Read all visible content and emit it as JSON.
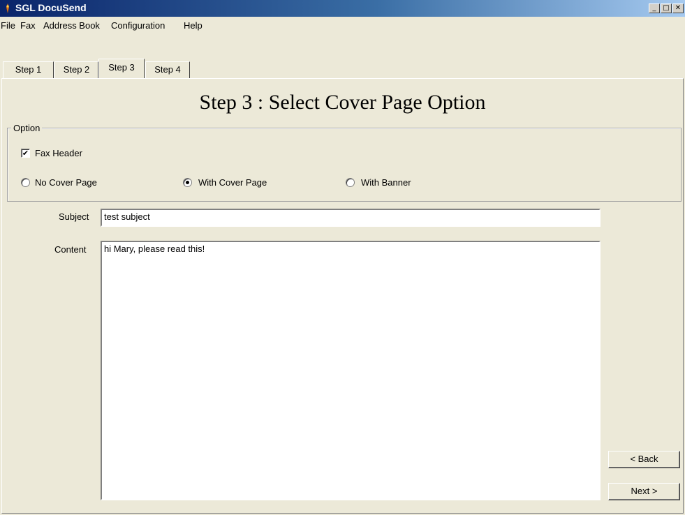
{
  "window": {
    "title": "SGL DocuSend",
    "minimize": "_",
    "maximize": "□",
    "close": "✕"
  },
  "menu": [
    "File",
    "Fax",
    "Address Book",
    "Configuration",
    "Help"
  ],
  "tabs": [
    "Step 1",
    "Step 2",
    "Step 3",
    "Step 4"
  ],
  "active_tab": "Step 3",
  "page_title": "Step 3 : Select Cover Page Option",
  "option_group": {
    "legend": "Option",
    "fax_header": {
      "label": "Fax Header",
      "checked": true,
      "mark": "✔"
    },
    "radios": [
      {
        "label": "No Cover Page",
        "selected": false
      },
      {
        "label": "With Cover Page",
        "selected": true
      },
      {
        "label": "With Banner",
        "selected": false
      }
    ]
  },
  "form": {
    "subject_label": "Subject",
    "subject_value": "test subject",
    "content_label": "Content",
    "content_value": "hi Mary, please read this!"
  },
  "buttons": {
    "back": "< Back",
    "next": "Next >"
  }
}
